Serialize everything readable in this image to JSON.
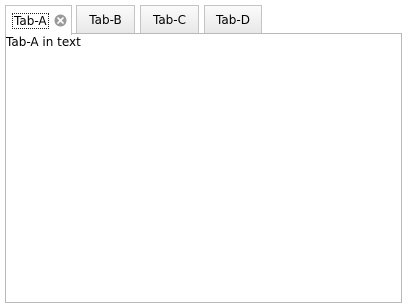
{
  "tabs": [
    {
      "label": "Tab-A",
      "active": true,
      "closable": true,
      "close_icon": "close-circle-icon"
    },
    {
      "label": "Tab-B",
      "active": false
    },
    {
      "label": "Tab-C",
      "active": false
    },
    {
      "label": "Tab-D",
      "active": false
    }
  ],
  "panel": {
    "content": "Tab-A in text"
  }
}
